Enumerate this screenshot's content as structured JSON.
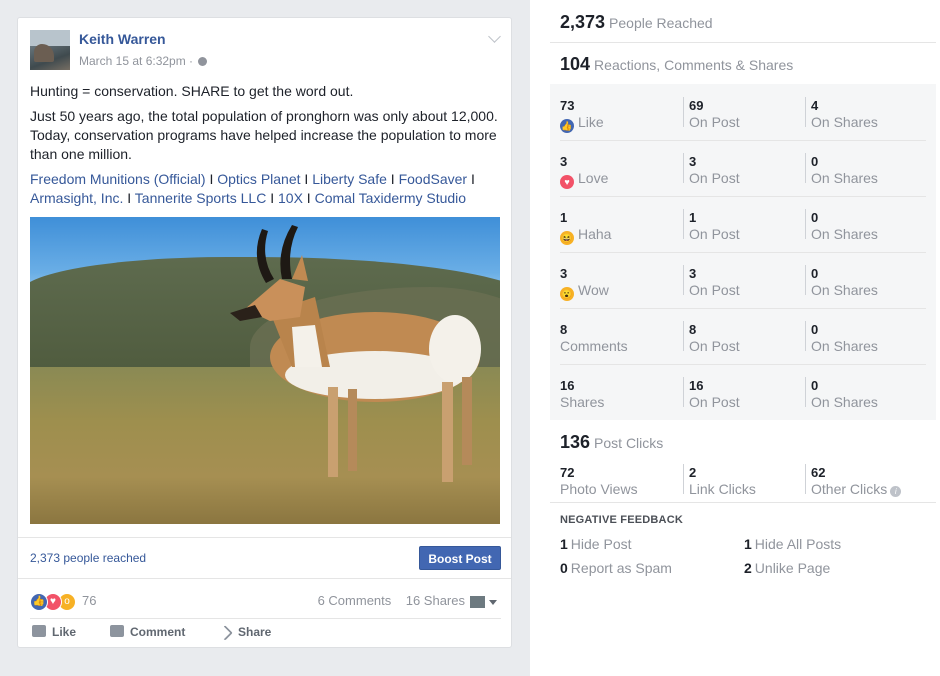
{
  "post": {
    "author": "Keith Warren",
    "timestamp": "March 15 at 6:32pm · ",
    "text_line1": "Hunting = conservation. SHARE to get the word out.",
    "text_line2": "Just 50 years ago, the total population of pronghorn was only about 12,000. Today, conservation programs have helped increase the population to more than one million.",
    "links": [
      "Freedom Munitions (Official)",
      "Optics Planet",
      "Liberty Safe",
      "FoodSaver",
      "Armasight, Inc.",
      "Tannerite Sports LLC",
      "10X",
      "Comal Taxidermy Studio"
    ],
    "separator": " I ",
    "people_reached": "2,373 people reached",
    "boost_label": "Boost Post",
    "reaction_count": "76",
    "comments": "6 Comments",
    "shares": "16 Shares",
    "actions": {
      "like": "Like",
      "comment": "Comment",
      "share": "Share"
    }
  },
  "insights": {
    "reached_num": "2,373",
    "reached_label": "People Reached",
    "engage_num": "104",
    "engage_label": "Reactions, Comments & Shares",
    "rows": [
      {
        "n1": "73",
        "l1": "Like",
        "n2": "69",
        "l2": "On Post",
        "n3": "4",
        "l3": "On Shares",
        "icon": "like-icon"
      },
      {
        "n1": "3",
        "l1": "Love",
        "n2": "3",
        "l2": "On Post",
        "n3": "0",
        "l3": "On Shares",
        "icon": "love-icon"
      },
      {
        "n1": "1",
        "l1": "Haha",
        "n2": "1",
        "l2": "On Post",
        "n3": "0",
        "l3": "On Shares",
        "icon": "haha-icon"
      },
      {
        "n1": "3",
        "l1": "Wow",
        "n2": "3",
        "l2": "On Post",
        "n3": "0",
        "l3": "On Shares",
        "icon": "wow-icon"
      },
      {
        "n1": "8",
        "l1": "Comments",
        "n2": "8",
        "l2": "On Post",
        "n3": "0",
        "l3": "On Shares",
        "icon": ""
      },
      {
        "n1": "16",
        "l1": "Shares",
        "n2": "16",
        "l2": "On Post",
        "n3": "0",
        "l3": "On Shares",
        "icon": ""
      }
    ],
    "clicks_num": "136",
    "clicks_label": "Post Clicks",
    "clicks": [
      {
        "n": "72",
        "l": "Photo Views"
      },
      {
        "n": "2",
        "l": "Link Clicks"
      },
      {
        "n": "62",
        "l": "Other Clicks"
      }
    ],
    "negative_header": "NEGATIVE FEEDBACK",
    "negative": [
      {
        "n": "1",
        "l": "Hide Post"
      },
      {
        "n": "1",
        "l": "Hide All Posts"
      },
      {
        "n": "0",
        "l": "Report as Spam"
      },
      {
        "n": "2",
        "l": "Unlike Page"
      }
    ]
  },
  "colors": {
    "link": "#365899",
    "like": "#4267b2",
    "love": "#f25268",
    "haha": "#f7b125",
    "wow": "#f7b125"
  }
}
